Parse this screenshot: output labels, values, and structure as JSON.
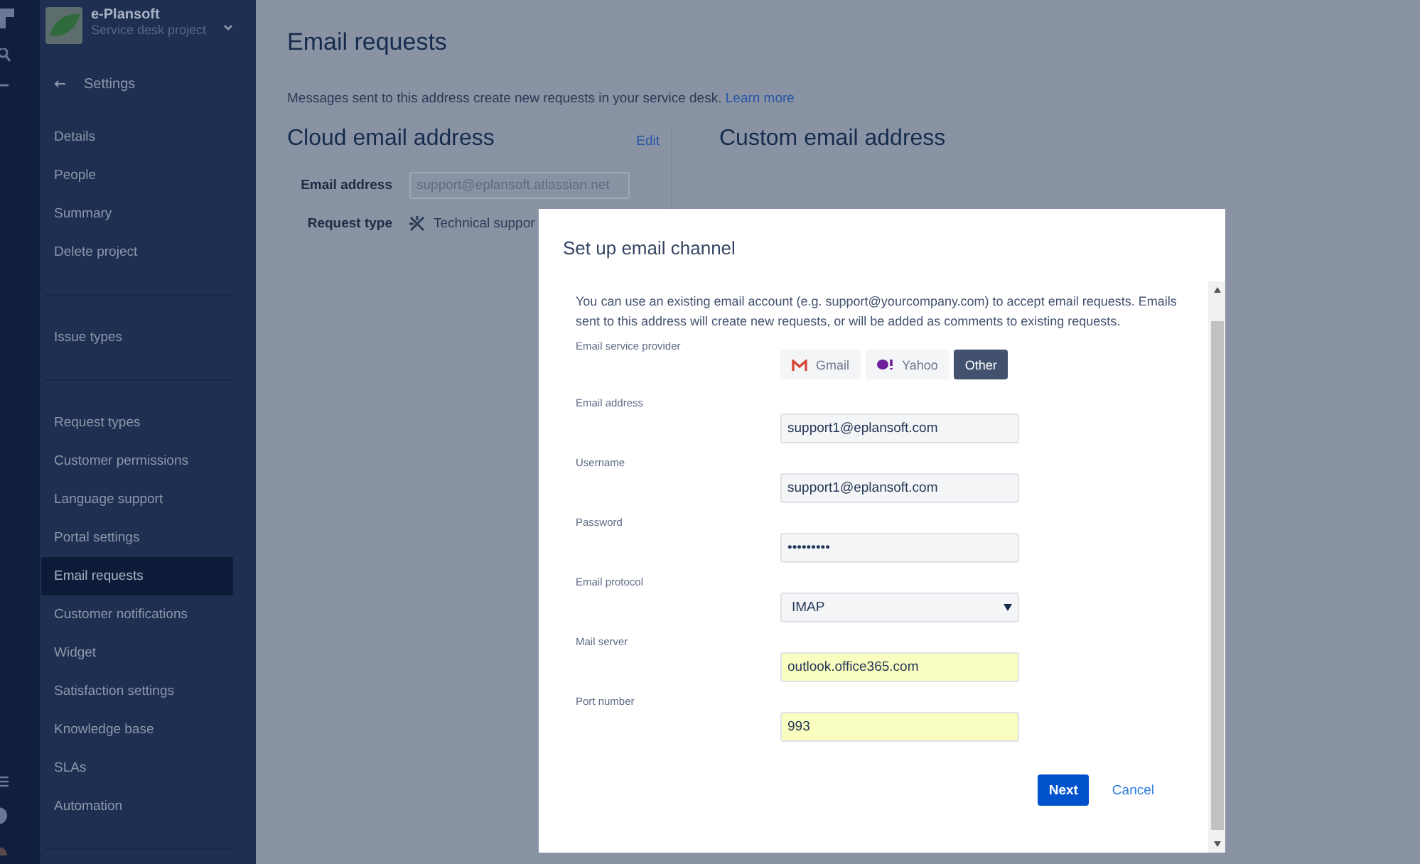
{
  "project": {
    "name": "e-Plansoft",
    "subtitle": "Service desk project"
  },
  "sidebar": {
    "back_label": "Settings",
    "groups": [
      {
        "items": [
          {
            "label": "Details",
            "selected": false
          },
          {
            "label": "People",
            "selected": false
          },
          {
            "label": "Summary",
            "selected": false
          },
          {
            "label": "Delete project",
            "selected": false
          }
        ]
      },
      {
        "items": [
          {
            "label": "Issue types",
            "selected": false
          }
        ]
      },
      {
        "items": [
          {
            "label": "Request types",
            "selected": false
          },
          {
            "label": "Customer permissions",
            "selected": false
          },
          {
            "label": "Language support",
            "selected": false
          },
          {
            "label": "Portal settings",
            "selected": false
          },
          {
            "label": "Email requests",
            "selected": true
          },
          {
            "label": "Customer notifications",
            "selected": false
          },
          {
            "label": "Widget",
            "selected": false
          },
          {
            "label": "Satisfaction settings",
            "selected": false
          },
          {
            "label": "Knowledge base",
            "selected": false
          },
          {
            "label": "SLAs",
            "selected": false
          },
          {
            "label": "Automation",
            "selected": false
          }
        ]
      }
    ]
  },
  "page": {
    "title": "Email requests",
    "description": "Messages sent to this address create new requests in your service desk.",
    "learn_more": "Learn more",
    "cloud": {
      "heading": "Cloud email address",
      "edit": "Edit",
      "email_label": "Email address",
      "email_value": "support@eplansoft.atlassian.net",
      "request_type_label": "Request type",
      "request_type_value": "Technical suppor"
    },
    "custom": {
      "heading": "Custom email address"
    }
  },
  "dialog": {
    "title": "Set up email channel",
    "intro": "You can use an existing email account (e.g. support@yourcompany.com) to accept email requests. Emails sent to this address will create new requests, or will be added as comments to existing requests.",
    "provider_label": "Email service provider",
    "providers": [
      {
        "kind": "gmail",
        "label": "Gmail",
        "selected": false
      },
      {
        "kind": "yahoo",
        "label": "Yahoo",
        "selected": false
      },
      {
        "kind": "other",
        "label": "Other",
        "selected": true
      }
    ],
    "fields": [
      {
        "kind": "text",
        "label": "Email address",
        "value": "support1@eplansoft.com",
        "autofilled": false
      },
      {
        "kind": "text",
        "label": "Username",
        "value": "support1@eplansoft.com",
        "autofilled": false
      },
      {
        "kind": "text",
        "label": "Password",
        "value": "•••••••••",
        "autofilled": false
      },
      {
        "kind": "select",
        "label": "Email protocol",
        "value": "IMAP",
        "autofilled": false
      },
      {
        "kind": "text",
        "label": "Mail server",
        "value": "outlook.office365.com",
        "autofilled": true
      },
      {
        "kind": "text",
        "label": "Port number",
        "value": "993",
        "autofilled": true
      }
    ],
    "next": "Next",
    "cancel": "Cancel"
  }
}
